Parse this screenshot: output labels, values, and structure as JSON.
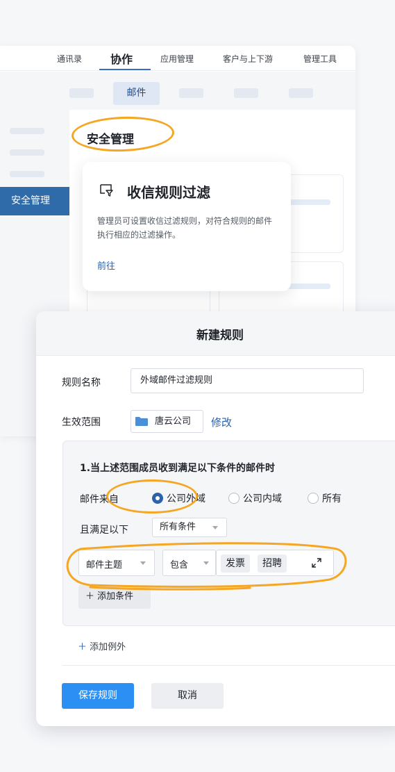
{
  "topnav": {
    "items": [
      "通讯录",
      "协作",
      "应用管理",
      "客户与上下游",
      "管理工具"
    ],
    "active_index": 1
  },
  "subnav": {
    "active_label": "邮件"
  },
  "sidebar": {
    "active_label": "安全管理"
  },
  "section": {
    "title": "安全管理"
  },
  "card": {
    "icon": "filter-icon",
    "title": "收信规则过滤",
    "description": "管理员可设置收信过滤规则，对符合规则的邮件执行相应的过滤操作。",
    "link": "前往"
  },
  "dialog": {
    "title": "新建规则",
    "name_label": "规则名称",
    "name_value": "外域邮件过滤规则",
    "scope_label": "生效范围",
    "scope_value": "唐云公司",
    "scope_icon": "folder-icon",
    "modify_link": "修改",
    "condition": {
      "title": "1.当上述范围成员收到满足以下条件的邮件时",
      "from_label": "邮件来自",
      "from_options": [
        {
          "label": "公司外域",
          "selected": true
        },
        {
          "label": "公司内域",
          "selected": false
        },
        {
          "label": "所有",
          "selected": false
        }
      ],
      "match_label": "且满足以下",
      "match_value": "所有条件",
      "field_value": "邮件主题",
      "operator_value": "包含",
      "keywords": [
        "发票",
        "招聘"
      ],
      "add_condition": "添加条件"
    },
    "add_exception": "添加例外",
    "save_button": "保存规则",
    "cancel_button": "取消"
  },
  "colors": {
    "accent": "#2b8ff3",
    "brand_blue": "#2e6ba8",
    "highlight": "#f5a623"
  }
}
